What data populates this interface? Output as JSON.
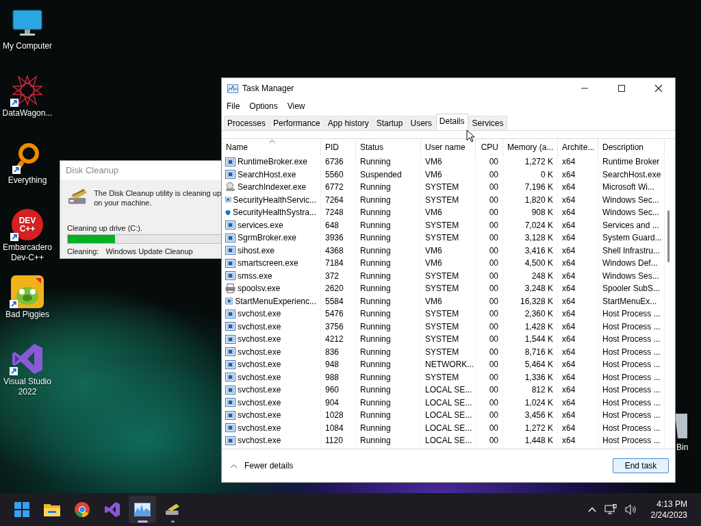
{
  "desktop_icons": [
    {
      "label": "My Computer",
      "kind": "computer",
      "shortcut": false
    },
    {
      "label": "DataWagon...",
      "kind": "star",
      "shortcut": true
    },
    {
      "label": "Everything",
      "kind": "magnifier",
      "shortcut": true
    },
    {
      "label": "Embarcadero Dev-C++",
      "kind": "devcpp",
      "shortcut": true,
      "logo_text": "DEV C++"
    },
    {
      "label": "Bad Piggies",
      "kind": "pig",
      "shortcut": true
    },
    {
      "label": "Visual Studio 2022",
      "kind": "vs",
      "shortcut": true
    }
  ],
  "recycle_bin": {
    "label": "Bin"
  },
  "disk_cleanup": {
    "title": "Disk Cleanup",
    "message_lines": [
      "The Disk Cleanup utility is cleaning up",
      "on your machine."
    ],
    "drive_text": "Cleaning up drive  (C:).",
    "level": 0.31,
    "cleaning_label": "Cleaning:",
    "cleaning_item": "Windows Update Cleanup"
  },
  "task_manager": {
    "title": "Task Manager",
    "menu": [
      "File",
      "Options",
      "View"
    ],
    "tabs": [
      {
        "label": "Processes",
        "selected": false
      },
      {
        "label": "Performance",
        "selected": false
      },
      {
        "label": "App history",
        "selected": false
      },
      {
        "label": "Startup",
        "selected": false
      },
      {
        "label": "Users",
        "selected": false
      },
      {
        "label": "Details",
        "selected": true
      },
      {
        "label": "Services",
        "selected": false
      }
    ],
    "columns": [
      "Name",
      "PID",
      "Status",
      "User name",
      "CPU",
      "Memory (a...",
      "Archite...",
      "Description"
    ],
    "rows": [
      {
        "kind": "app",
        "cells": [
          "RuntimeBroker.exe",
          "6736",
          "Running",
          "VM6",
          "00",
          "1,272 K",
          "x64",
          "Runtime Broker"
        ]
      },
      {
        "kind": "app",
        "cells": [
          "SearchHost.exe",
          "5560",
          "Suspended",
          "VM6",
          "00",
          "0 K",
          "x64",
          "SearchHost.exe"
        ]
      },
      {
        "kind": "search",
        "cells": [
          "SearchIndexer.exe",
          "6772",
          "Running",
          "SYSTEM",
          "00",
          "7,196 K",
          "x64",
          "Microsoft Wi..."
        ]
      },
      {
        "kind": "app",
        "cells": [
          "SecurityHealthServic...",
          "7264",
          "Running",
          "SYSTEM",
          "00",
          "1,820 K",
          "x64",
          "Windows Sec..."
        ]
      },
      {
        "kind": "shield",
        "cells": [
          "SecurityHealthSystra...",
          "7248",
          "Running",
          "VM6",
          "00",
          "908 K",
          "x64",
          "Windows Sec..."
        ]
      },
      {
        "kind": "app",
        "cells": [
          "services.exe",
          "648",
          "Running",
          "SYSTEM",
          "00",
          "7,024 K",
          "x64",
          "Services and ..."
        ]
      },
      {
        "kind": "app",
        "cells": [
          "SgrmBroker.exe",
          "3936",
          "Running",
          "SYSTEM",
          "00",
          "3,128 K",
          "x64",
          "System Guard..."
        ]
      },
      {
        "kind": "app",
        "cells": [
          "sihost.exe",
          "4368",
          "Running",
          "VM6",
          "00",
          "3,416 K",
          "x64",
          "Shell Infrastru..."
        ]
      },
      {
        "kind": "app",
        "cells": [
          "smartscreen.exe",
          "7184",
          "Running",
          "VM6",
          "00",
          "4,500 K",
          "x64",
          "Windows Def..."
        ]
      },
      {
        "kind": "app",
        "cells": [
          "smss.exe",
          "372",
          "Running",
          "SYSTEM",
          "00",
          "248 K",
          "x64",
          "Windows Ses..."
        ]
      },
      {
        "kind": "printer",
        "cells": [
          "spoolsv.exe",
          "2620",
          "Running",
          "SYSTEM",
          "00",
          "3,248 K",
          "x64",
          "Spooler SubS..."
        ]
      },
      {
        "kind": "app",
        "cells": [
          "StartMenuExperienc...",
          "5584",
          "Running",
          "VM6",
          "00",
          "16,328 K",
          "x64",
          "StartMenuEx..."
        ]
      },
      {
        "kind": "app",
        "cells": [
          "svchost.exe",
          "5476",
          "Running",
          "SYSTEM",
          "00",
          "2,360 K",
          "x64",
          "Host Process ..."
        ]
      },
      {
        "kind": "app",
        "cells": [
          "svchost.exe",
          "3756",
          "Running",
          "SYSTEM",
          "00",
          "1,428 K",
          "x64",
          "Host Process ..."
        ]
      },
      {
        "kind": "app",
        "cells": [
          "svchost.exe",
          "4212",
          "Running",
          "SYSTEM",
          "00",
          "1,544 K",
          "x64",
          "Host Process ..."
        ]
      },
      {
        "kind": "app",
        "cells": [
          "svchost.exe",
          "836",
          "Running",
          "SYSTEM",
          "00",
          "8,716 K",
          "x64",
          "Host Process ..."
        ]
      },
      {
        "kind": "app",
        "cells": [
          "svchost.exe",
          "948",
          "Running",
          "NETWORK...",
          "00",
          "5,464 K",
          "x64",
          "Host Process ..."
        ]
      },
      {
        "kind": "app",
        "cells": [
          "svchost.exe",
          "988",
          "Running",
          "SYSTEM",
          "00",
          "1,336 K",
          "x64",
          "Host Process ..."
        ]
      },
      {
        "kind": "app",
        "cells": [
          "svchost.exe",
          "960",
          "Running",
          "LOCAL SE...",
          "00",
          "812 K",
          "x64",
          "Host Process ..."
        ]
      },
      {
        "kind": "app",
        "cells": [
          "svchost.exe",
          "904",
          "Running",
          "LOCAL SE...",
          "00",
          "1,024 K",
          "x64",
          "Host Process ..."
        ]
      },
      {
        "kind": "app",
        "cells": [
          "svchost.exe",
          "1028",
          "Running",
          "LOCAL SE...",
          "00",
          "3,456 K",
          "x64",
          "Host Process ..."
        ]
      },
      {
        "kind": "app",
        "cells": [
          "svchost.exe",
          "1084",
          "Running",
          "LOCAL SE...",
          "00",
          "1,272 K",
          "x64",
          "Host Process ..."
        ]
      },
      {
        "kind": "app",
        "cells": [
          "svchost.exe",
          "1120",
          "Running",
          "LOCAL SE...",
          "00",
          "1,448 K",
          "x64",
          "Host Process ..."
        ]
      }
    ],
    "fewer_details": "Fewer details",
    "end_task": "End task"
  },
  "taskbar": {
    "apps": [
      {
        "kind": "start",
        "active": false,
        "running": false
      },
      {
        "kind": "folder",
        "active": false,
        "running": false
      },
      {
        "kind": "browser",
        "active": false,
        "running": false
      },
      {
        "kind": "vs",
        "active": false,
        "running": false
      },
      {
        "kind": "taskmgr",
        "active": true,
        "running": true
      },
      {
        "kind": "cleanup",
        "active": false,
        "running": true
      }
    ],
    "time": "4:13 PM",
    "date": "2/24/2023"
  }
}
